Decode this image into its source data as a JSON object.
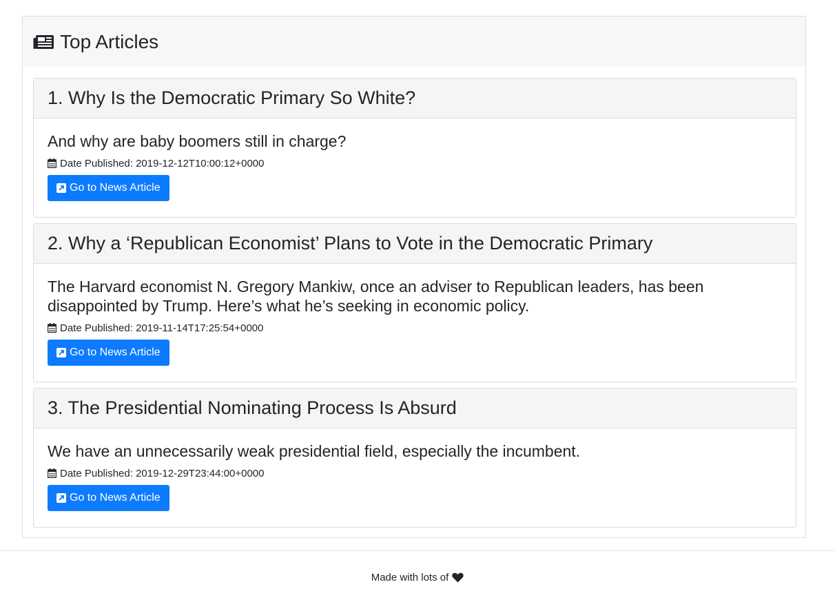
{
  "panel": {
    "title": "Top Articles",
    "icon": "newspaper-icon"
  },
  "articles": [
    {
      "title": "1. Why Is the Democratic Primary So White?",
      "description": "And why are baby boomers still in charge?",
      "date": "Date Published: 2019-12-12T10:00:12+0000",
      "button": "Go to News Article"
    },
    {
      "title": "2. Why a ‘Republican Economist’ Plans to Vote in the Democratic Primary",
      "description": "The Harvard economist N. Gregory Mankiw, once an adviser to Republican leaders, has been disappointed by Trump. Here’s what he’s seeking in economic policy.",
      "date": "Date Published: 2019-11-14T17:25:54+0000",
      "button": "Go to News Article"
    },
    {
      "title": "3. The Presidential Nominating Process Is Absurd",
      "description": "We have an unnecessarily weak presidential field, especially the incumbent.",
      "date": "Date Published: 2019-12-29T23:44:00+0000",
      "button": "Go to News Article"
    }
  ],
  "footer": {
    "text": "Made with lots of",
    "icon": "heart-icon"
  },
  "colors": {
    "button": "#0d7bff",
    "header_bg": "#f7f7f7"
  }
}
